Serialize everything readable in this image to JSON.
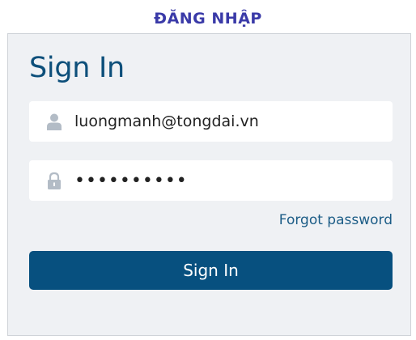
{
  "header": {
    "title": "ĐĂNG NHẬP"
  },
  "login_card": {
    "title": "Sign In",
    "username": {
      "value": "luongmanh@tongdai.vn",
      "icon": "user-icon"
    },
    "password": {
      "value": "••••••••••",
      "icon": "lock-icon"
    },
    "forgot_password_label": "Forgot password",
    "submit_label": "Sign In"
  },
  "colors": {
    "header_text": "#3a3aa8",
    "card_background": "#eff1f4",
    "title_text": "#0d4f7a",
    "link_text": "#1b5c86",
    "button_background": "#07507f",
    "icon_gray": "#b3bcc6"
  }
}
